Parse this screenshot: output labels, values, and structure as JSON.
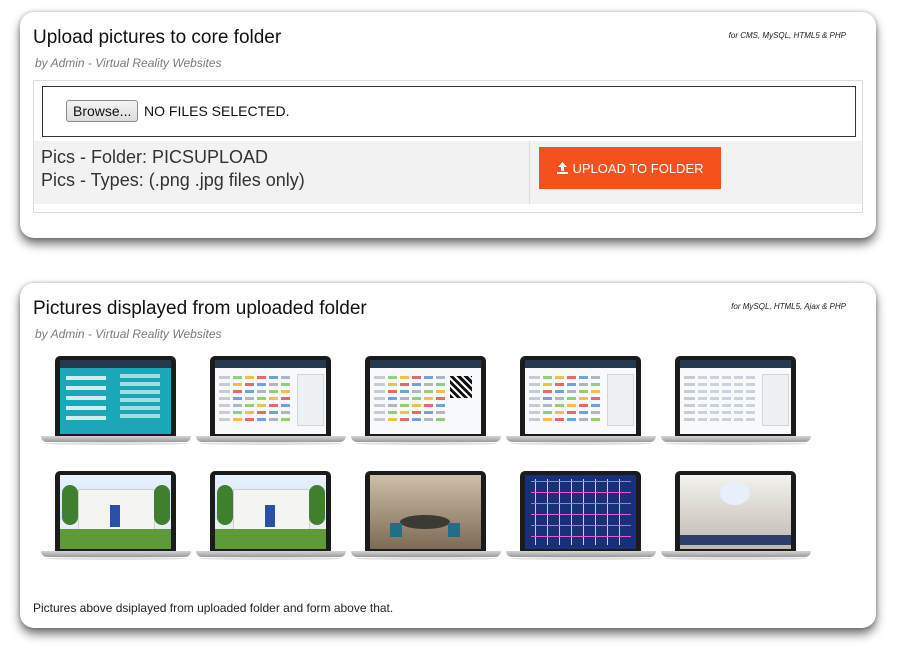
{
  "upload_card": {
    "title": "Upload pictures to core folder",
    "subtitle": "by Admin - Virtual Reality Websites",
    "tag": "for CMS, MySQL, HTML5 & PHP",
    "browse_label": "Browse...",
    "file_status": "NO FILES SELECTED.",
    "folder_line": "Pics - Folder: PICSUPLOAD",
    "types_line": "Pics - Types: (.png .jpg files only)",
    "upload_button_label": "UPLOAD TO FOLDER",
    "upload_icon": "upload-icon",
    "accent_color": "#f4511e"
  },
  "gallery_card": {
    "title": "Pictures displayed from uploaded folder",
    "subtitle": "by Admin - Virtual Reality Websites",
    "tag": "for MySQL, HTML5, Ajax & PHP",
    "caption": "Pictures above dsiplayed from uploaded folder and form above that.",
    "pictures": [
      {
        "kind": "dashboard-teal"
      },
      {
        "kind": "dashboard-table"
      },
      {
        "kind": "dashboard-qr"
      },
      {
        "kind": "dashboard-table"
      },
      {
        "kind": "dashboard-list"
      },
      {
        "kind": "house-exterior"
      },
      {
        "kind": "house-exterior"
      },
      {
        "kind": "interior-dining"
      },
      {
        "kind": "floor-plan"
      },
      {
        "kind": "interior-panorama"
      }
    ]
  }
}
